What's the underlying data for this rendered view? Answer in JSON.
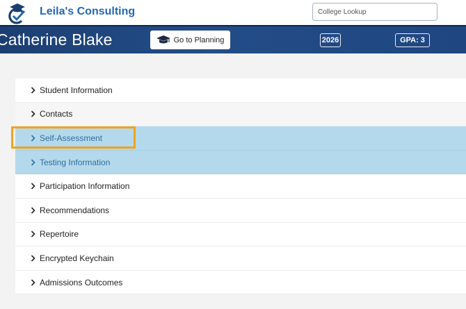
{
  "brand": {
    "name": "Leila's Consulting"
  },
  "search": {
    "placeholder": "College Lookup"
  },
  "student": {
    "name": "Catherine Blake",
    "planning_button": "Go to Planning",
    "year": "2026",
    "gpa": "GPA: 3"
  },
  "sections": [
    {
      "label": "Student Information",
      "selected": false
    },
    {
      "label": "Contacts",
      "selected": false
    },
    {
      "label": "Self-Assessment",
      "selected": true,
      "highlighted": true
    },
    {
      "label": "Testing Information",
      "selected": true
    },
    {
      "label": "Participation Information",
      "selected": false
    },
    {
      "label": "Recommendations",
      "selected": false
    },
    {
      "label": "Repertoire",
      "selected": false
    },
    {
      "label": "Encrypted Keychain",
      "selected": false
    },
    {
      "label": "Admissions Outcomes",
      "selected": false
    }
  ],
  "colors": {
    "brand": "#2368b3",
    "header": "#1f4680",
    "selected_row": "#b5d9ec",
    "highlight": "#f3a21c"
  },
  "icons": [
    "logo-checkmark-cap-icon",
    "graduation-cap-icon",
    "chevron-right-icon"
  ]
}
